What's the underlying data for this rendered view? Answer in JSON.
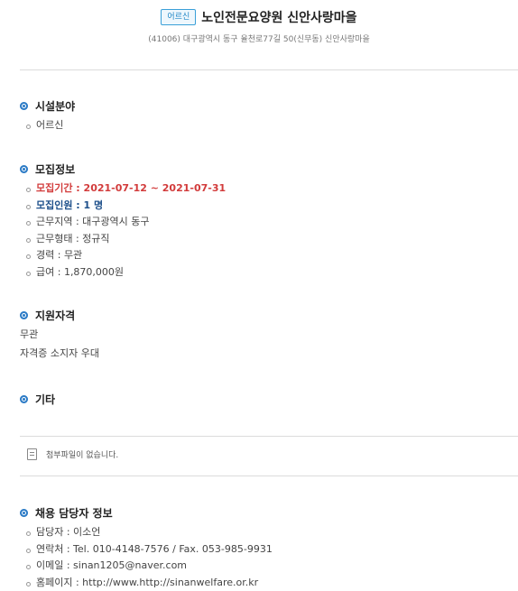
{
  "header": {
    "badge": "어르신",
    "title": "노인전문요양원 신안사랑마을",
    "address": "(41006) 대구광역시 동구 율천로77길 50(신무동) 신안사랑마을"
  },
  "sections": {
    "field": {
      "title": "시설분야",
      "items": [
        "어르신"
      ]
    },
    "recruit": {
      "title": "모집정보",
      "period_label": "모집기간 : 2021-07-12 ~ 2021-07-31",
      "headcount_label": "모집인원 : 1 명",
      "region": "근무지역 : 대구광역시 동구",
      "type": "근무형태 : 정규직",
      "career": "경력 : 무관",
      "salary": "급여 : 1,870,000원"
    },
    "qualification": {
      "title": "지원자격",
      "lines": [
        "무관",
        "자격증 소지자 우대"
      ]
    },
    "etc": {
      "title": "기타"
    },
    "contact": {
      "title": "채용 담당자 정보",
      "manager": "담당자 : 이소언",
      "phone": "연락처 : Tel. 010-4148-7576 / Fax. 053-985-9931",
      "email": "이메일 : sinan1205@naver.com",
      "homepage": "홈페이지 : http://www.http://sinanwelfare.or.kr"
    }
  },
  "attachment": {
    "icon": "file-icon",
    "text": "첨부파일이 없습니다."
  },
  "colors": {
    "accent": "#2c7bc6",
    "highlight_red": "#d23b3b",
    "highlight_blue": "#1d4f8a"
  }
}
